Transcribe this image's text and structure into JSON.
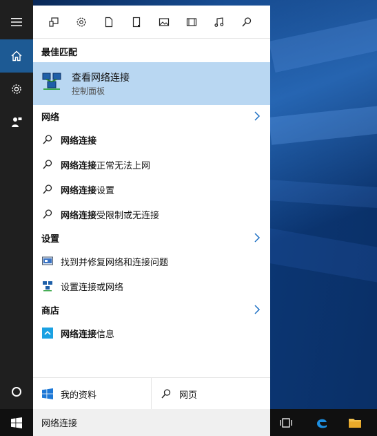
{
  "filters": [
    {
      "name": "apps-filter-icon"
    },
    {
      "name": "settings-filter-icon"
    },
    {
      "name": "documents-filter-icon"
    },
    {
      "name": "folders-filter-icon"
    },
    {
      "name": "photos-filter-icon"
    },
    {
      "name": "videos-filter-icon"
    },
    {
      "name": "music-filter-icon"
    },
    {
      "name": "web-filter-icon"
    }
  ],
  "best_match": {
    "header": "最佳匹配",
    "title": "查看网络连接",
    "subtitle": "控制面板"
  },
  "network": {
    "header": "网络",
    "items": [
      {
        "bold": "网络连接",
        "rest": ""
      },
      {
        "bold": "网络连接",
        "rest": "正常无法上网"
      },
      {
        "bold": "网络连接",
        "rest": "设置"
      },
      {
        "bold": "网络连接",
        "rest": "受限制或无连接"
      }
    ]
  },
  "settings": {
    "header": "设置",
    "items": [
      {
        "label": "找到并修复网络和连接问题"
      },
      {
        "label": "设置连接或网络"
      }
    ]
  },
  "store": {
    "header": "商店",
    "items": [
      {
        "bold": "网络连接",
        "rest": "信息"
      }
    ]
  },
  "bottom": {
    "my_stuff": "我的资料",
    "web": "网页"
  },
  "taskbar": {
    "search_text": "网络连接"
  },
  "colors": {
    "accent": "#1d5a94",
    "highlight": "#b9d7f2",
    "chevron": "#1d6fc4"
  }
}
